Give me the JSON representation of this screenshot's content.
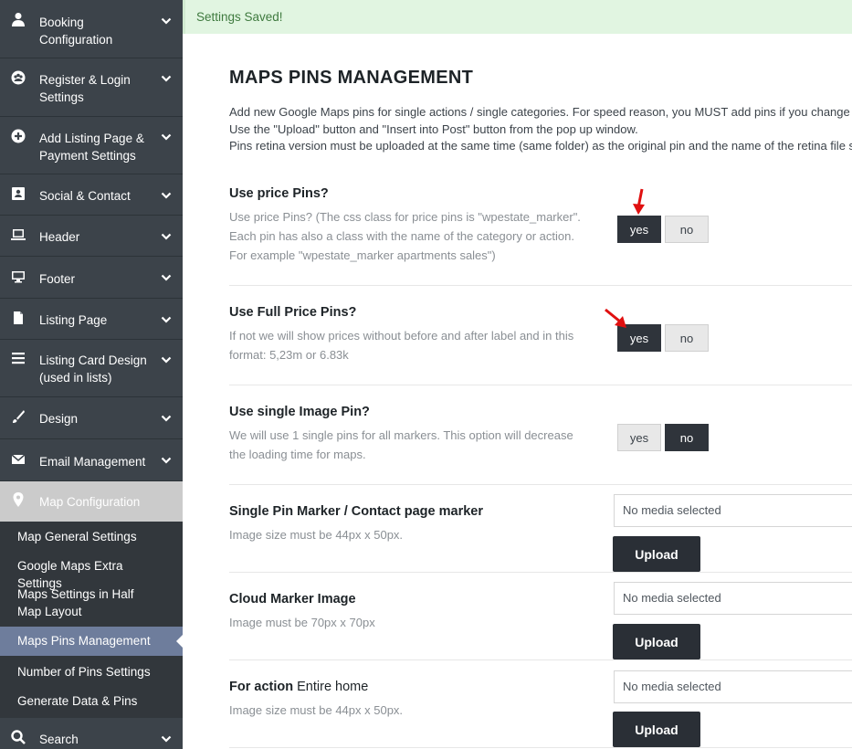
{
  "sidebar": {
    "items": [
      {
        "label": "Booking Configuration",
        "icon": "user-icon"
      },
      {
        "label": "Register & Login Settings",
        "icon": "users-icon"
      },
      {
        "label": "Add Listing Page & Payment Settings",
        "icon": "plus-circle-icon"
      },
      {
        "label": "Social & Contact",
        "icon": "contact-card-icon"
      },
      {
        "label": "Header",
        "icon": "laptop-icon"
      },
      {
        "label": "Footer",
        "icon": "monitor-icon"
      },
      {
        "label": "Listing Page",
        "icon": "page-icon"
      },
      {
        "label": "Listing Card Design (used in lists)",
        "icon": "list-icon"
      },
      {
        "label": "Design",
        "icon": "brush-icon"
      },
      {
        "label": "Email Management",
        "icon": "envelope-icon"
      },
      {
        "label": "Map Configuration",
        "icon": "map-pin-icon"
      }
    ],
    "subitems": [
      {
        "label": "Map General Settings"
      },
      {
        "label": "Google Maps Extra Settings"
      },
      {
        "label": "Maps Settings in Half Map Layout"
      },
      {
        "label": "Maps Pins Management"
      },
      {
        "label": "Number of Pins Settings"
      },
      {
        "label": "Generate Data & Pins"
      }
    ],
    "bottom_item": {
      "label": "Search",
      "icon": "search-icon"
    }
  },
  "notice": "Settings Saved!",
  "page_title": "MAPS PINS MANAGEMENT",
  "intro": [
    "Add new Google Maps pins for single actions / single categories. For speed reason, you MUST add pins if you change c",
    "Use the \"Upload\" button and \"Insert into Post\" button from the pop up window.",
    "Pins retina version must be uploaded at the same time (same folder) as the original pin and the name of the retina file s"
  ],
  "settings": {
    "price_pins": {
      "title": "Use price Pins?",
      "desc": "Use price Pins? (The css class for price pins is \"wpestate_marker\". Each pin has also a class with the name of the category or action. For example \"wpestate_marker apartments sales\")",
      "yes": "yes",
      "no": "no",
      "selected": "yes"
    },
    "full_price_pins": {
      "title": "Use Full Price Pins?",
      "desc": "If not we will show prices without before and after label and in this format: 5,23m or 6.83k",
      "yes": "yes",
      "no": "no",
      "selected": "yes"
    },
    "single_image_pin": {
      "title": "Use single Image Pin?",
      "desc": "We will use 1 single pins for all markers. This option will decrease the loading time for maps.",
      "yes": "yes",
      "no": "no",
      "selected": "no"
    },
    "single_pin_marker": {
      "title": "Single Pin Marker / Contact page marker",
      "desc": "Image size must be 44px x 50px.",
      "media": "No media selected",
      "upload": "Upload"
    },
    "cloud_marker": {
      "title": "Cloud Marker Image",
      "desc": "Image must be 70px x 70px",
      "media": "No media selected",
      "upload": "Upload"
    },
    "action_entire_home": {
      "title_bold": "For action",
      "title_rest": "Entire home",
      "desc": "Image size must be 44px x 50px.",
      "media": "No media selected",
      "upload": "Upload"
    }
  },
  "colors": {
    "sidebar_bg": "#3c434a",
    "active_sub": "#6e7d9c",
    "toggle_on": "#2f343b",
    "arrow": "#e01010"
  }
}
